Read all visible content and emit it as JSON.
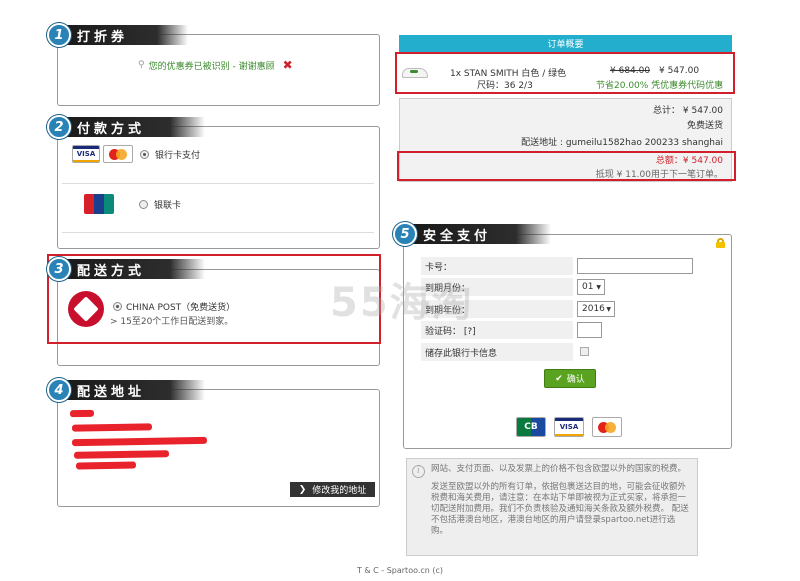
{
  "sections": {
    "coupon": {
      "num": "1",
      "title": "打折券",
      "message": "您的优惠券已被识别 - 谢谢惠顾"
    },
    "payment": {
      "num": "2",
      "title": "付款方式",
      "bank_card_label": "银行卡支付",
      "unionpay_label": "银联卡"
    },
    "shipping": {
      "num": "3",
      "title": "配送方式",
      "option_label": "CHINA POST（免费送货）",
      "option_detail": "> 15至20个工作日配送到家。"
    },
    "address": {
      "num": "4",
      "title": "配送地址",
      "edit_label": "修改我的地址"
    },
    "secure": {
      "num": "5",
      "title": "安全支付"
    }
  },
  "cards": {
    "visa": "VISA",
    "mastercard": "MasterCard",
    "unionpay": "UnionPay",
    "cb": "CB"
  },
  "summary": {
    "title": "订单概要",
    "item": {
      "name": "1x STAN SMITH 白色 / 绿色",
      "size": "尺码：36 2/3",
      "old_price": "¥ 684.00",
      "price": "¥ 547.00",
      "saving": "节省20.00% 凭优惠券代码优惠"
    },
    "total_label": "总计：",
    "total_value": "¥ 547.00",
    "free_shipping": "免费送货",
    "address_label": "配送地址 : gumeilu1582hao 200233 shanghai",
    "grand_total": "总额：¥ 547.00",
    "credit_note": "抵现 ¥ 11.00用于下一笔订单。"
  },
  "form": {
    "card_number_label": "卡号：",
    "expiry_month_label": "到期月份：",
    "expiry_year_label": "到期年份：",
    "cvv_label": "验证码： [?]",
    "save_card_label": "储存此银行卡信息",
    "month_value": "01",
    "year_value": "2016",
    "confirm_label": "确认"
  },
  "notice": {
    "line1": "网站、支付页面、以及发票上的价格不包含欧盟以外的国家的税费。",
    "line2": "发送至欧盟以外的所有订单，依据包裹送达目的地，可能会征收额外税费和海关费用，请注意：在本站下单即被视为正式买家，将承担一切配送附加费用。我们不负责核验及通知海关条款及额外税费。 配送不包括港澳台地区，港澳台地区的用户请登录spartoo.net进行选购。"
  },
  "watermark": "55海淘",
  "footer": "T & C - Spartoo.cn (c)",
  "colors": {
    "accent": "#23aecd",
    "highlight": "#d1202b",
    "confirm": "#5aa321"
  }
}
